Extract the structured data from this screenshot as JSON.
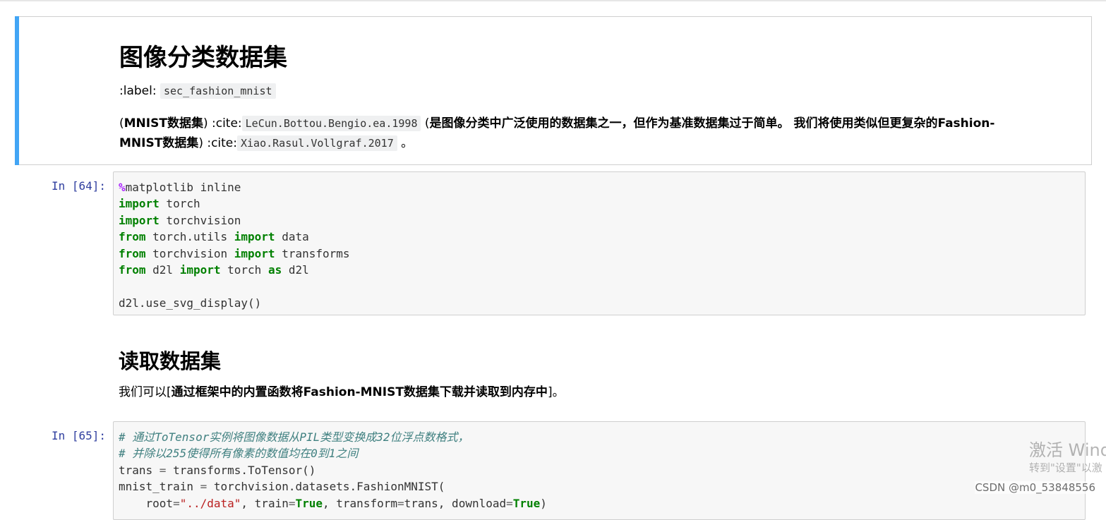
{
  "markdown_cell_1": {
    "heading": "图像分类数据集",
    "label_prefix": ":label:",
    "label_code": "sec_fashion_mnist",
    "para_open": "(",
    "para_bold_1": "MNIST数据集",
    "para_cite_1_prefix": ") :cite:",
    "para_cite_1_code": "LeCun.Bottou.Bengio.ea.1998",
    "para_open_2": " (",
    "para_bold_2": "是图像分类中广泛使用的数据集之一，但作为基准数据集过于简单。 我们将使用类似但更复杂的Fashion-",
    "para_bold_3": "MNIST数据集",
    "para_cite_2_prefix": ") :cite:",
    "para_cite_2_code": "Xiao.Rasul.Vollgraf.2017",
    "para_end": " 。"
  },
  "code_cell_1": {
    "prompt": "In  [64]:",
    "lines": [
      "%matplotlib inline",
      "import torch",
      "import torchvision",
      "from torch.utils import data",
      "from torchvision import transforms",
      "from d2l import torch as d2l",
      "",
      "d2l.use_svg_display()"
    ]
  },
  "markdown_cell_2": {
    "heading": "读取数据集",
    "text_prefix": "我们可以[",
    "text_bold": "通过框架中的内置函数将Fashion-MNIST数据集下载并读取到内存中",
    "text_suffix": "]。"
  },
  "code_cell_2": {
    "prompt": "In  [65]:",
    "comment_1": "# 通过ToTensor实例将图像数据从PIL类型变换成32位浮点数格式，",
    "comment_2": "# 并除以255使得所有像素的数值均在0到1之间",
    "line_3": "trans = transforms.ToTensor()",
    "line_4": "mnist_train = torchvision.datasets.FashionMNIST(",
    "line_5": "    root=\"../data\", train=True, transform=trans, download=True)"
  },
  "overlay": {
    "watermark_line1": "激活 Wind",
    "watermark_line2": "转到\"设置\"以激",
    "csdn": "CSDN @m0_53848556"
  },
  "colors": {
    "selection_bar": "#42a5f5",
    "prompt": "#303f9f",
    "keyword": "#008000",
    "magic": "#aa22ff",
    "comment": "#408080",
    "string": "#ba2121"
  }
}
